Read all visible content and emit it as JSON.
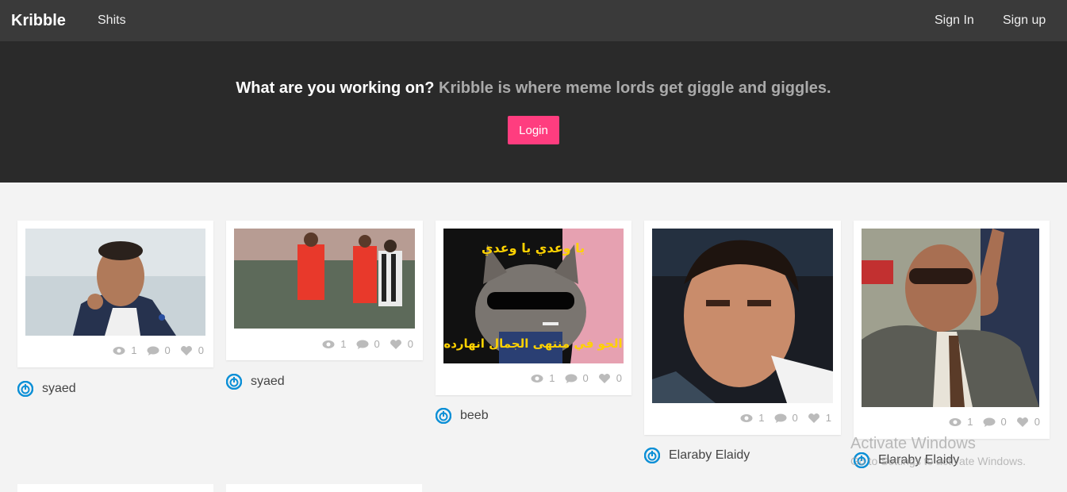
{
  "nav": {
    "brand": "Kribble",
    "shits_label": "Shits",
    "sign_in_label": "Sign In",
    "sign_up_label": "Sign up"
  },
  "hero": {
    "title_bold": "What are you working on?",
    "title_muted": "Kribble is where meme lords get giggle and giggles.",
    "login_label": "Login"
  },
  "posts": [
    {
      "views": "1",
      "comments": "0",
      "likes": "0",
      "author": "syaed"
    },
    {
      "views": "1",
      "comments": "0",
      "likes": "0",
      "author": "syaed"
    },
    {
      "views": "1",
      "comments": "0",
      "likes": "0",
      "author": "beeb",
      "image_text_top": "يا وعدي يا وعدي",
      "image_text_bottom": "الجو في منتهى الجمال انهارده"
    },
    {
      "views": "1",
      "comments": "0",
      "likes": "1",
      "author": "Elaraby Elaidy"
    },
    {
      "views": "1",
      "comments": "0",
      "likes": "0",
      "author": "Elaraby Elaidy"
    }
  ],
  "icons": {
    "views": "eye-icon",
    "comments": "comment-icon",
    "likes": "heart-icon",
    "author": "power-icon"
  },
  "colors": {
    "navbar": "#3a3a3a",
    "hero": "#2a2a2a",
    "accent": "#ff3d7f",
    "author_icon": "#0b8fd6"
  },
  "watermark": {
    "title": "Activate Windows",
    "subtitle": "Go to Settings to activate Windows."
  }
}
